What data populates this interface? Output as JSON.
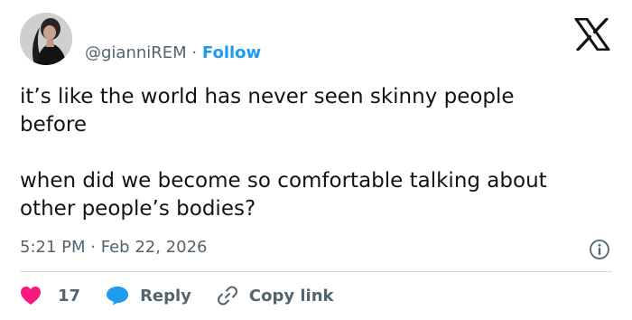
{
  "header": {
    "handle": "@gianniREM",
    "separator": "·",
    "follow_label": "Follow",
    "avatar_icon": "profile-photo",
    "brand_icon": "x-logo-icon"
  },
  "tweet": {
    "text": "it’s like the world has never seen skinny people\nbefore\n\nwhen did we become so comfortable talking about\nother people’s bodies?",
    "time": "5:21 PM",
    "separator": "·",
    "date": "Feb 22, 2026"
  },
  "actions": {
    "like_count": "17",
    "reply_label": "Reply",
    "copy_link_label": "Copy link"
  },
  "colors": {
    "accent": "#1d9bf0",
    "like": "#f91880",
    "muted": "#536471",
    "text": "#0f1419",
    "divider": "#cfd9de"
  }
}
